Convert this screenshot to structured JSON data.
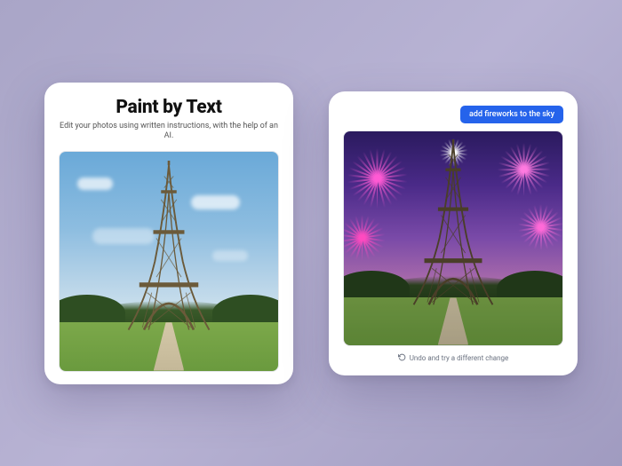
{
  "left": {
    "title": "Paint by Text",
    "subtitle": "Edit your photos using written instructions, with the help of an AI."
  },
  "right": {
    "prompt_chip": "add fireworks to the sky",
    "undo_label": "Undo and try a different change"
  }
}
